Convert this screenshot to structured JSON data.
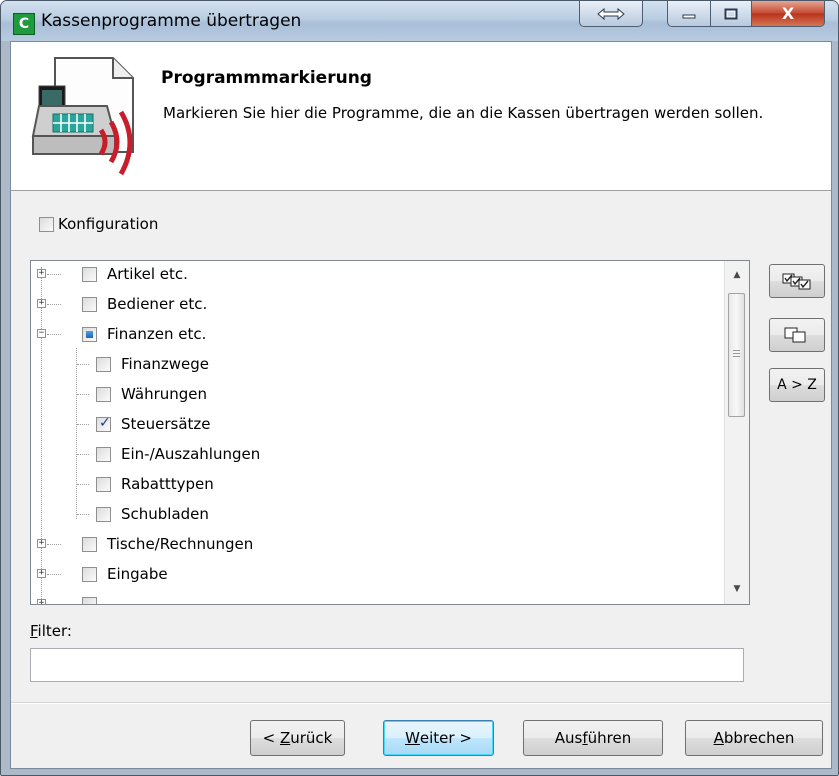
{
  "window": {
    "title": "Kassenprogramme übertragen",
    "app_icon_letter": "C",
    "controls": [
      "resize",
      "minimize",
      "maximize",
      "close"
    ]
  },
  "header": {
    "title": "Programmmarkierung",
    "description": "Markieren Sie hier die Programme, die an die Kassen übertragen werden sollen."
  },
  "konfiguration": {
    "label": "Konfiguration",
    "checked": false
  },
  "tree": {
    "items": [
      {
        "label": "Artikel etc.",
        "level": 0,
        "expander": "+",
        "state": "unchecked"
      },
      {
        "label": "Bediener etc.",
        "level": 0,
        "expander": "+",
        "state": "unchecked"
      },
      {
        "label": "Finanzen etc.",
        "level": 0,
        "expander": "-",
        "state": "indeterminate"
      },
      {
        "label": "Finanzwege",
        "level": 1,
        "state": "unchecked"
      },
      {
        "label": "Währungen",
        "level": 1,
        "state": "unchecked"
      },
      {
        "label": "Steuersätze",
        "level": 1,
        "state": "checked"
      },
      {
        "label": "Ein-/Auszahlungen",
        "level": 1,
        "state": "unchecked"
      },
      {
        "label": "Rabatttypen",
        "level": 1,
        "state": "unchecked"
      },
      {
        "label": "Schubladen",
        "level": 1,
        "state": "unchecked"
      },
      {
        "label": "Tische/Rechnungen",
        "level": 0,
        "expander": "+",
        "state": "unchecked"
      },
      {
        "label": "Eingabe",
        "level": 0,
        "expander": "+",
        "state": "unchecked"
      }
    ]
  },
  "side_buttons": {
    "select_all_icon": "check-all-icon",
    "deselect_all_icon": "uncheck-all-icon",
    "sort_label": "A > Z"
  },
  "filter": {
    "label_first": "F",
    "label_rest": "ilter:",
    "value": ""
  },
  "buttons": {
    "back_prefix": "< ",
    "back_accel": "Z",
    "back_rest": "urück",
    "next_accel": "W",
    "next_rest": "eiter >",
    "execute_pre": "Aus",
    "execute_accel": "f",
    "execute_rest": "ühren",
    "cancel_accel": "A",
    "cancel_rest": "bbrechen"
  },
  "colors": {
    "title_close": "#c2472f",
    "header_bg": "#ffffff",
    "client_bg": "#f0f0f0",
    "default_button_border": "#3c7fb1"
  }
}
